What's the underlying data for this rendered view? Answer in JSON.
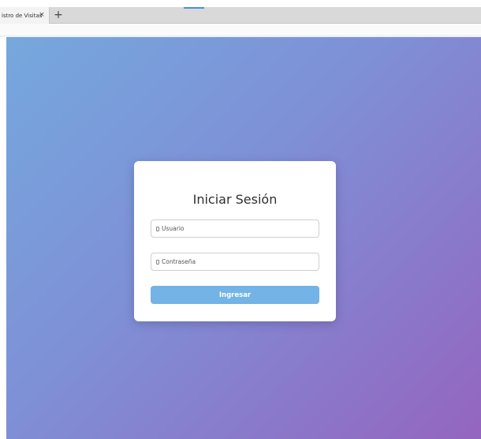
{
  "browser": {
    "tab_title": "istro de Visitas",
    "tab_close": "×",
    "new_tab": "+"
  },
  "login": {
    "title": "Iniciar Sesión",
    "username_placeholder": "Usuario",
    "password_placeholder": "Contraseña",
    "submit_label": "Ingresar"
  },
  "colors": {
    "gradient_start": "#75a8dd",
    "gradient_end": "#9465bf",
    "button": "#73b3e6"
  }
}
